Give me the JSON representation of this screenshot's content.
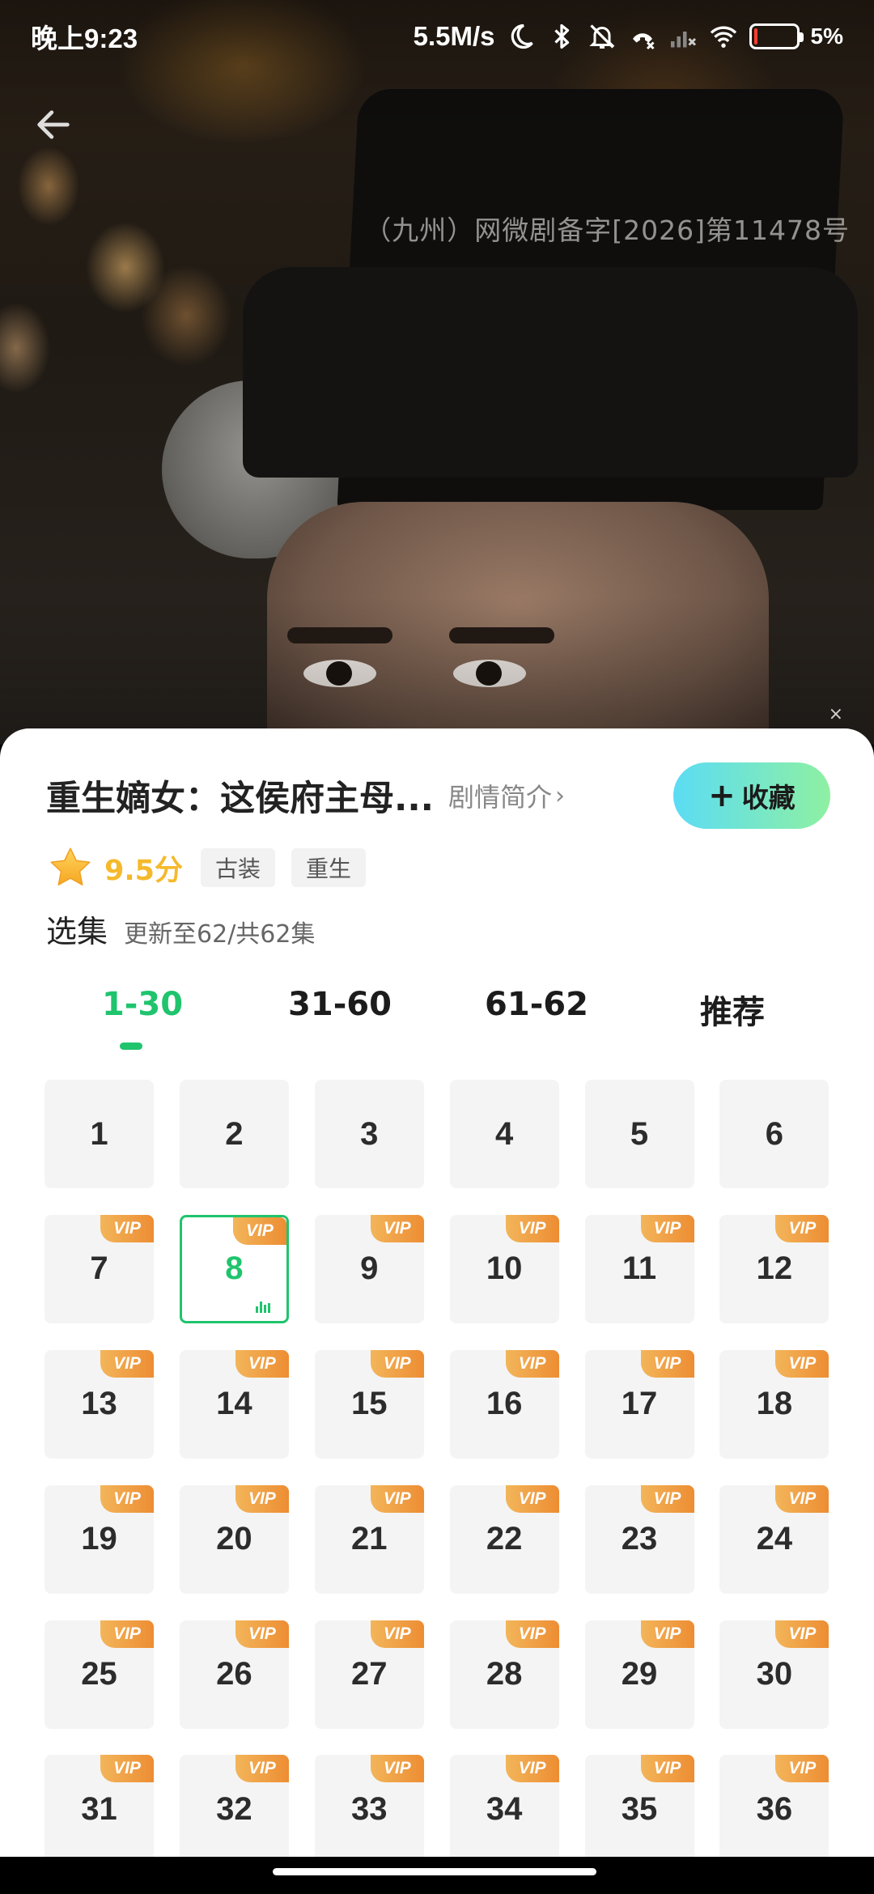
{
  "status_bar": {
    "time": "晚上9:23",
    "network_speed": "5.5M/s",
    "battery_percent": "5%",
    "battery_level": 0.05,
    "icons": [
      "moon-icon",
      "bluetooth-icon",
      "mute-bell-icon",
      "hd-call-icon",
      "signal-icon",
      "wifi-icon",
      "battery-icon"
    ]
  },
  "player": {
    "back_icon": "arrow-left-icon",
    "registration_watermark": "（九州）网微剧备字[2026]第11478号",
    "close_label": "×"
  },
  "drama": {
    "title": "重生嫡女：这侯府主母...",
    "synopsis_label": "剧情简介",
    "synopsis_chevron": "›",
    "collect_plus": "+",
    "collect_label": "收藏",
    "rating": "9.5分",
    "tags": [
      "古装",
      "重生"
    ]
  },
  "episodes": {
    "section_label": "选集",
    "update_status": "更新至62/共62集",
    "tabs": [
      "1-30",
      "31-60",
      "61-62",
      "推荐"
    ],
    "active_tab": 0,
    "selected_episode": 8,
    "free_through": 6,
    "vip_badge": "VIP",
    "visible": [
      "1",
      "2",
      "3",
      "4",
      "5",
      "6",
      "7",
      "8",
      "9",
      "10",
      "11",
      "12",
      "13",
      "14",
      "15",
      "16",
      "17",
      "18",
      "19",
      "20",
      "21",
      "22",
      "23",
      "24",
      "25",
      "26",
      "27",
      "28",
      "29",
      "30",
      "31",
      "32",
      "33",
      "34",
      "35",
      "36"
    ]
  },
  "colors": {
    "accent_green": "#1fc46d",
    "rating_gold": "#f5b92c",
    "vip_orange": "#ed8d33"
  }
}
